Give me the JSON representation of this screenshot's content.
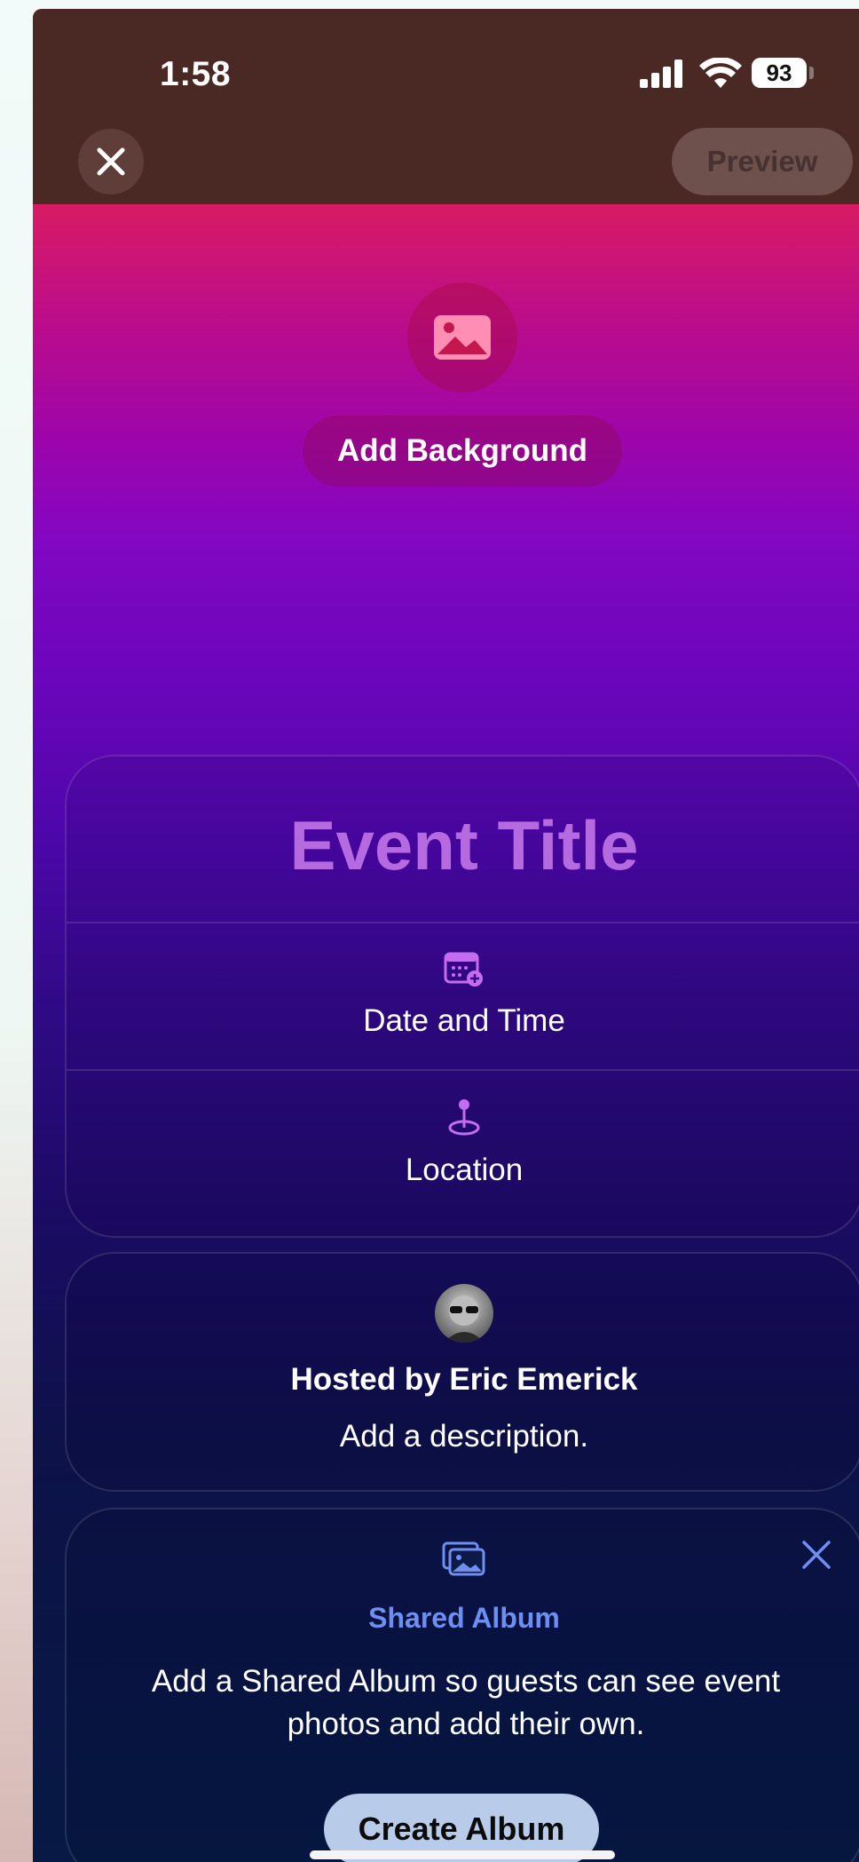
{
  "status_bar": {
    "time": "1:58",
    "battery": "93"
  },
  "nav": {
    "preview_label": "Preview"
  },
  "header": {
    "add_background_label": "Add Background"
  },
  "event": {
    "title_placeholder": "Event Title",
    "date_time_label": "Date and Time",
    "location_label": "Location"
  },
  "host": {
    "hosted_by": "Hosted by Eric Emerick",
    "description_placeholder": "Add a description."
  },
  "shared_album": {
    "title": "Shared Album",
    "description": "Add a Shared Album so guests can see event photos and add their own.",
    "create_label": "Create Album"
  },
  "colors": {
    "accent": "#6f8ff0",
    "title_placeholder": "#b56ae0",
    "topbar": "#4a2824"
  }
}
